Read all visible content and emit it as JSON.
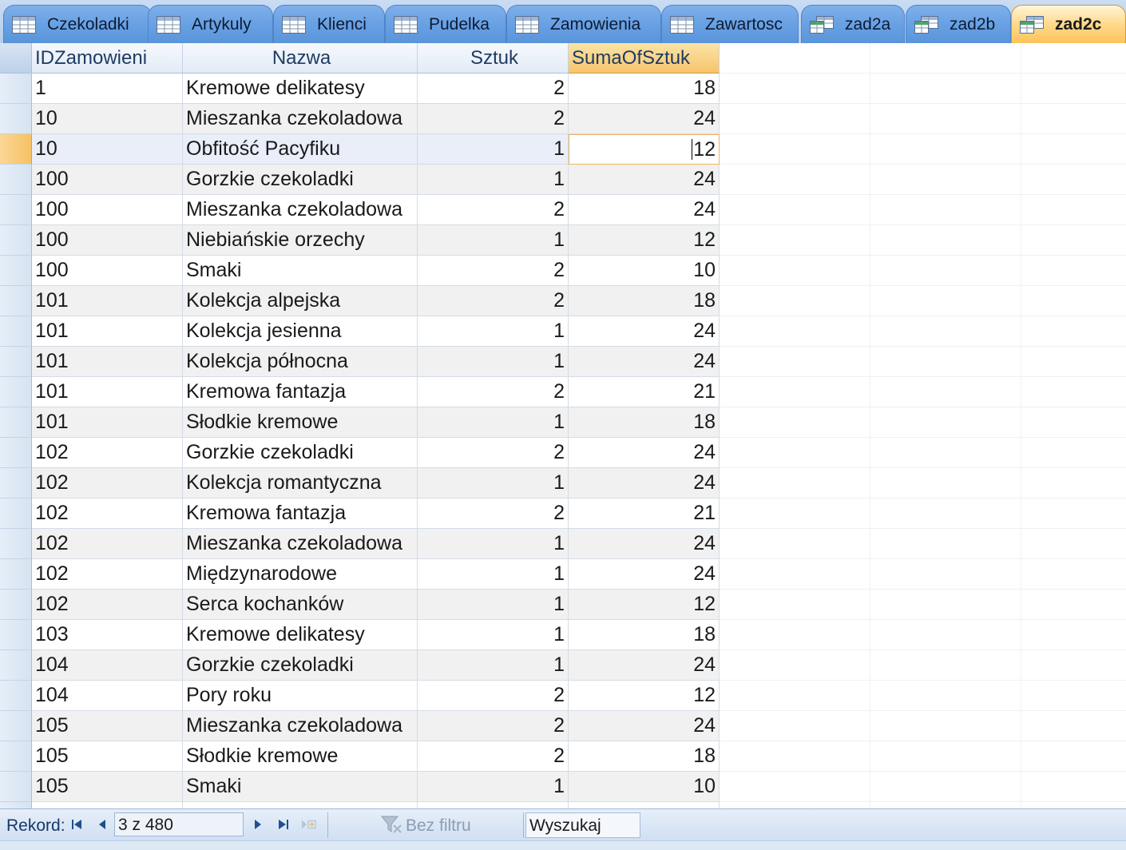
{
  "tabs": [
    {
      "label": "Czekoladki",
      "icon": "table-icon",
      "active": false
    },
    {
      "label": "Artykuly",
      "icon": "table-icon",
      "active": false
    },
    {
      "label": "Klienci",
      "icon": "table-icon",
      "active": false
    },
    {
      "label": "Pudelka",
      "icon": "table-icon",
      "active": false
    },
    {
      "label": "Zamowienia",
      "icon": "table-icon",
      "active": false
    },
    {
      "label": "Zawartosc",
      "icon": "table-icon",
      "active": false
    },
    {
      "label": "zad2a",
      "icon": "query-icon",
      "active": false
    },
    {
      "label": "zad2b",
      "icon": "query-icon",
      "active": false
    },
    {
      "label": "zad2c",
      "icon": "query-icon",
      "active": true
    }
  ],
  "datasheet": {
    "columns": [
      "IDZamowieni",
      "Nazwa",
      "Sztuk",
      "SumaOfSztuk"
    ],
    "sorted_column": "SumaOfSztuk",
    "current_row": 2,
    "rows": [
      [
        "1",
        "Kremowe delikatesy",
        "2",
        "18"
      ],
      [
        "10",
        "Mieszanka czekoladowa",
        "2",
        "24"
      ],
      [
        "10",
        "Obfitość Pacyfiku",
        "1",
        "12"
      ],
      [
        "100",
        "Gorzkie czekoladki",
        "1",
        "24"
      ],
      [
        "100",
        "Mieszanka czekoladowa",
        "2",
        "24"
      ],
      [
        "100",
        "Niebiańskie orzechy",
        "1",
        "12"
      ],
      [
        "100",
        "Smaki",
        "2",
        "10"
      ],
      [
        "101",
        "Kolekcja alpejska",
        "2",
        "18"
      ],
      [
        "101",
        "Kolekcja jesienna",
        "1",
        "24"
      ],
      [
        "101",
        "Kolekcja północna",
        "1",
        "24"
      ],
      [
        "101",
        "Kremowa fantazja",
        "2",
        "21"
      ],
      [
        "101",
        "Słodkie kremowe",
        "1",
        "18"
      ],
      [
        "102",
        "Gorzkie czekoladki",
        "2",
        "24"
      ],
      [
        "102",
        "Kolekcja romantyczna",
        "1",
        "24"
      ],
      [
        "102",
        "Kremowa fantazja",
        "2",
        "21"
      ],
      [
        "102",
        "Mieszanka czekoladowa",
        "1",
        "24"
      ],
      [
        "102",
        "Międzynarodowe",
        "1",
        "24"
      ],
      [
        "102",
        "Serca kochanków",
        "1",
        "12"
      ],
      [
        "103",
        "Kremowe delikatesy",
        "1",
        "18"
      ],
      [
        "104",
        "Gorzkie czekoladki",
        "1",
        "24"
      ],
      [
        "104",
        "Pory roku",
        "2",
        "12"
      ],
      [
        "105",
        "Mieszanka czekoladowa",
        "2",
        "24"
      ],
      [
        "105",
        "Słodkie kremowe",
        "2",
        "18"
      ],
      [
        "105",
        "Smaki",
        "1",
        "10"
      ]
    ]
  },
  "navigation": {
    "record_label": "Rekord:",
    "record_position": "3 z 480",
    "filter_label": "Bez filtru",
    "search_placeholder": "Wyszukaj"
  },
  "colors": {
    "tab_inactive": "#6aa2e4",
    "tab_active": "#ffd98a",
    "header_sorted": "#f6c46c",
    "current_row_selector": "#f6c163"
  }
}
